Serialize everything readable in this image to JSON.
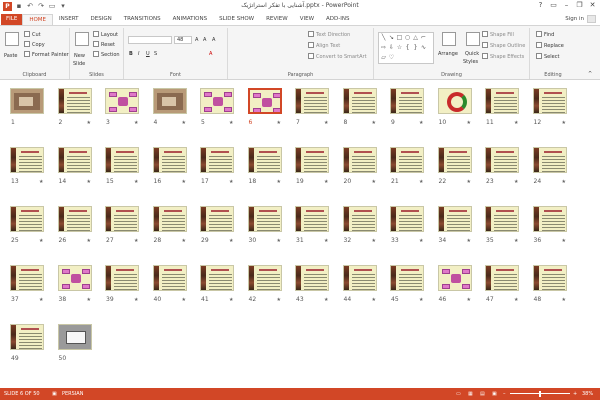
{
  "window": {
    "title": "آشنایی با تفکر استراتژیک.pptx - PowerPoint",
    "app_icon": "P",
    "help": "?",
    "minimize": "–",
    "restore": "❐",
    "close": "✕"
  },
  "qat": {
    "save": "▪",
    "undo": "↶",
    "redo": "↷",
    "present": "▭",
    "more": "▾"
  },
  "tabs": {
    "file": "FILE",
    "items": [
      "HOME",
      "INSERT",
      "DESIGN",
      "TRANSITIONS",
      "ANIMATIONS",
      "SLIDE SHOW",
      "REVIEW",
      "VIEW",
      "ADD-INS"
    ],
    "active": "HOME"
  },
  "account": {
    "sign_in": "Sign in"
  },
  "ribbon": {
    "clipboard": {
      "label": "Clipboard",
      "paste": "Paste",
      "cut": "Cut",
      "copy": "Copy",
      "format_painter": "Format Painter"
    },
    "slides": {
      "label": "Slides",
      "new_slide": "New",
      "new_slide_2": "Slide",
      "layout": "Layout",
      "reset": "Reset",
      "section": "Section"
    },
    "font": {
      "label": "Font",
      "size_up": "A",
      "size_down": "A",
      "clear": "A",
      "bold": "B",
      "italic": "I",
      "underline": "U",
      "strike": "S",
      "font_color": "A",
      "size_value": "48"
    },
    "paragraph": {
      "label": "Paragraph",
      "text_direction": "Text Direction",
      "align_text": "Align Text",
      "convert_smartart": "Convert to SmartArt"
    },
    "drawing": {
      "label": "Drawing",
      "arrange": "Arrange",
      "quick_styles": "Quick",
      "quick_styles_2": "Styles",
      "shape_fill": "Shape Fill",
      "shape_outline": "Shape Outline",
      "shape_effects": "Shape Effects"
    },
    "editing": {
      "label": "Editing",
      "find": "Find",
      "replace": "Replace",
      "select": "Select"
    }
  },
  "slides": {
    "selected": 6,
    "numbers": [
      "1",
      "2",
      "3",
      "4",
      "5",
      "6",
      "7",
      "8",
      "9",
      "10",
      "11",
      "12",
      "13",
      "14",
      "15",
      "16",
      "17",
      "18",
      "19",
      "20",
      "21",
      "22",
      "23",
      "24",
      "25",
      "26",
      "27",
      "28",
      "29",
      "30",
      "31",
      "32",
      "33",
      "34",
      "35",
      "36",
      "37",
      "38",
      "39",
      "40",
      "41",
      "42",
      "43",
      "44",
      "45",
      "46",
      "47",
      "48",
      "49",
      "50"
    ],
    "star": "★"
  },
  "status": {
    "slide_info": "SLIDE 6 OF 50",
    "language": "PERSIAN",
    "zoom": "38%",
    "zoom_out": "–",
    "zoom_in": "+",
    "zoom_fraction": 0.38
  },
  "colors": {
    "accent": "#d24726",
    "slide_bg": "#f2efc4"
  }
}
